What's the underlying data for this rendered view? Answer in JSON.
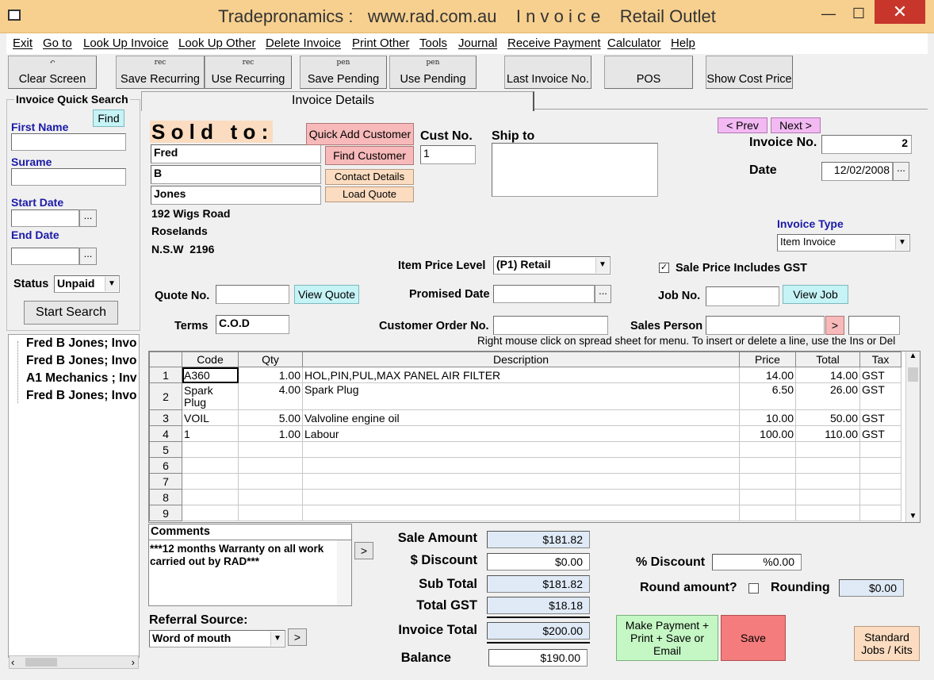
{
  "window": {
    "title": "Tradepronamics :   www.rad.com.au    I n v o i c e    Retail Outlet",
    "min": "—",
    "max": "☐",
    "close": "✕"
  },
  "menu": [
    "Exit",
    "Go to",
    "Look Up Invoice",
    "Look Up Other",
    "Delete Invoice",
    "Print Other",
    "Tools",
    "Journal",
    "Receive Payment",
    "Calculator",
    "Help"
  ],
  "toolbar": {
    "clear": {
      "small": "↶",
      "label": "Clear Screen"
    },
    "save_recurring": {
      "small": "rec",
      "label": "Save Recurring"
    },
    "use_recurring": {
      "small": "rec",
      "label": "Use Recurring"
    },
    "save_pending": {
      "small": "pen",
      "label": "Save Pending"
    },
    "use_pending": {
      "small": "pen",
      "label": "Use Pending"
    },
    "last_invoice": "Last Invoice No.",
    "pos": "POS",
    "show_cost": "Show Cost Price"
  },
  "search": {
    "title": "Invoice Quick Search",
    "find": "Find",
    "first_name": "First Name",
    "surname": "Surame",
    "start_date": "Start Date",
    "end_date": "End Date",
    "status_label": "Status",
    "status_value": "Unpaid",
    "start_search": "Start Search",
    "dots": "..."
  },
  "results": [
    "Fred B Jones; Invo",
    "Fred B Jones; Invo",
    "A1 Mechanics  ; Inv",
    "Fred B Jones; Invo"
  ],
  "tab": "Invoice Details",
  "sold": {
    "heading": "S o l d   t o :",
    "line1": "Fred",
    "line2": "B",
    "line3": "Jones",
    "addr1": "192 Wigs Road",
    "addr2": "Roselands",
    "addr3": "N.S.W  2196"
  },
  "buttons": {
    "quick_add": "Quick Add Customer",
    "find_customer": "Find Customer",
    "contact_details": "Contact Details",
    "load_quote": "Load Quote",
    "view_quote": "View Quote",
    "view_job": "View Job",
    "prev": "< Prev",
    "next": "Next >",
    "arrow": ">",
    "make_payment": "Make Payment + Print + Save or Email",
    "save": "Save",
    "standard_jobs": "Standard Jobs / Kits"
  },
  "cust": {
    "label": "Cust No.",
    "value": "1"
  },
  "ship": {
    "label": "Ship to"
  },
  "invoice": {
    "no_label": "Invoice No.",
    "no_value": "2",
    "date_label": "Date",
    "date_value": "12/02/2008",
    "type_label": "Invoice Type",
    "type_value": "Item Invoice"
  },
  "pricing": {
    "level_label": "Item Price Level",
    "level_value": "(P1) Retail",
    "gst_check": "✓",
    "gst_label": "Sale Price Includes GST"
  },
  "fields": {
    "quote_label": "Quote No.",
    "promised_label": "Promised Date",
    "job_label": "Job No.",
    "terms_label": "Terms",
    "terms_value": "C.O.D",
    "order_label": "Customer Order No.",
    "sales_label": "Sales Person",
    "hint": "Right mouse click on spread sheet for menu. To insert or delete a line, use the Ins or Del"
  },
  "grid": {
    "headers": [
      "Code",
      "Qty",
      "Description",
      "Price",
      "Total",
      "Tax"
    ],
    "rows": [
      {
        "n": "1",
        "code": "A360",
        "qty": "1.00",
        "desc": "HOL,PIN,PUL,MAX PANEL AIR FILTER",
        "price": "14.00",
        "total": "14.00",
        "tax": "GST"
      },
      {
        "n": "2",
        "code": "Spark Plug",
        "qty": "4.00",
        "desc": "Spark Plug",
        "price": "6.50",
        "total": "26.00",
        "tax": "GST"
      },
      {
        "n": "3",
        "code": "VOIL",
        "qty": "5.00",
        "desc": "Valvoline engine oil",
        "price": "10.00",
        "total": "50.00",
        "tax": "GST"
      },
      {
        "n": "4",
        "code": "1",
        "qty": "1.00",
        "desc": "Labour",
        "price": "100.00",
        "total": "110.00",
        "tax": "GST"
      },
      {
        "n": "5"
      },
      {
        "n": "6"
      },
      {
        "n": "7"
      },
      {
        "n": "8"
      },
      {
        "n": "9"
      }
    ]
  },
  "comments": {
    "label": "Comments",
    "text": "***12 months Warranty on all work carried out by RAD***"
  },
  "referral": {
    "label": "Referral Source:",
    "value": "Word of mouth"
  },
  "totals": {
    "sale_label": "Sale Amount",
    "sale": "$181.82",
    "disc_label": "$ Discount",
    "disc": "$0.00",
    "sub_label": "Sub Total",
    "sub": "$181.82",
    "gst_label": "Total GST",
    "gst": "$18.18",
    "inv_label": "Invoice Total",
    "inv": "$200.00",
    "bal_label": "Balance",
    "bal": "$190.00"
  },
  "discount": {
    "pct_label": "% Discount",
    "pct": "%0.00",
    "round_label": "Round amount?",
    "rounding_label": "Rounding",
    "rounding": "$0.00"
  },
  "colors": {
    "title_bg": "#f7d08f",
    "close": "#c7352b",
    "pink": "#f7b9b9",
    "peach": "#fbdcc0",
    "cyan": "#c6f3f6",
    "green": "#c5f7c5",
    "red": "#f47c7c"
  }
}
